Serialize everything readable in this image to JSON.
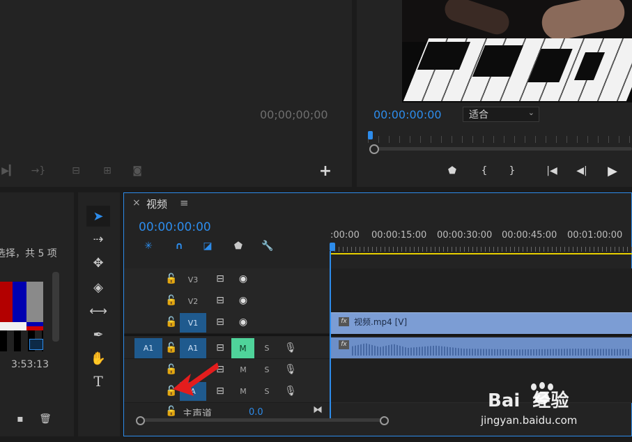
{
  "source_monitor": {
    "timecode": "00;00;00;00",
    "controls": [
      "mark-out-icon",
      "insert-icon",
      "overwrite-icon",
      "extract-icon",
      "camera-icon"
    ],
    "add_label": "+"
  },
  "program_monitor": {
    "timecode": "00:00:00:00",
    "fit_label": "适合",
    "controls": [
      "marker-icon",
      "mark-in-icon",
      "mark-out-icon",
      "go-to-in-icon",
      "step-back-icon",
      "play-icon"
    ]
  },
  "project_panel": {
    "selection_text": "选择，共 5 项",
    "duration": "3:53:13"
  },
  "timeline": {
    "close_label": "×",
    "title": "视频",
    "menu_label": "≡",
    "timecode": "00:00:00:00",
    "ruler_labels": [
      ":00:00",
      "00:00:15:00",
      "00:00:30:00",
      "00:00:45:00",
      "00:01:00:00"
    ],
    "tracks": [
      {
        "id": "V3",
        "label": "V3",
        "source": "",
        "type": "video"
      },
      {
        "id": "V2",
        "label": "V2",
        "source": "",
        "type": "video"
      },
      {
        "id": "V1",
        "label": "V1",
        "source": "",
        "type": "video"
      },
      {
        "id": "A1",
        "label": "A1",
        "source": "A1",
        "type": "audio",
        "m": "M",
        "s": "S"
      },
      {
        "id": "A2",
        "label": "",
        "source": "",
        "type": "audio",
        "m": "M",
        "s": "S"
      },
      {
        "id": "A3",
        "label": "A",
        "source": "",
        "type": "audio",
        "m": "M",
        "s": "S"
      }
    ],
    "master": {
      "label": "主声道",
      "value": "0.0"
    },
    "clip_video": {
      "label": "视频.mp4 [V]",
      "fx": "fx"
    },
    "clip_audio": {
      "fx": "fx"
    }
  },
  "watermark": {
    "brand": "Bai  经验",
    "url": "jingyan.baidu.com"
  },
  "colors": {
    "accent": "#2d8ceb",
    "clip_video": "#7c9dd4",
    "clip_audio": "#6d8fc8",
    "mute_on": "#4fd39a",
    "track_on": "#1f5a8e"
  }
}
